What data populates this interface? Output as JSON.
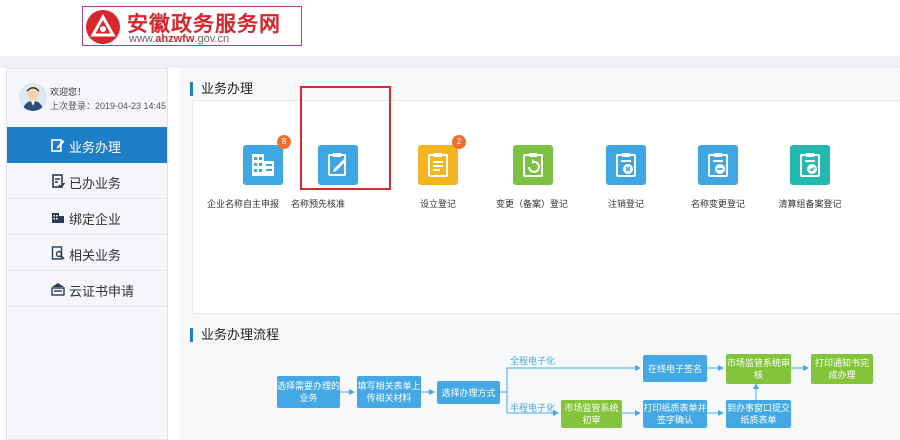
{
  "header": {
    "logo_title": "安徽政务服务网",
    "logo_url_prefix": "www.",
    "logo_url_bold": "ahzwfw",
    "logo_url_suffix": ".gov.cn"
  },
  "user": {
    "welcome": "欢迎您！",
    "last_login": "上次登录：2019-04-23 14:45"
  },
  "sidebar": {
    "items": [
      {
        "label": "业务办理",
        "icon": "edit-icon",
        "active": true
      },
      {
        "label": "已办业务",
        "icon": "document-check-icon",
        "active": false
      },
      {
        "label": "绑定企业",
        "icon": "building-icon",
        "active": false
      },
      {
        "label": "相关业务",
        "icon": "search-document-icon",
        "active": false
      },
      {
        "label": "云证书申请",
        "icon": "certificate-icon",
        "active": false
      }
    ]
  },
  "main": {
    "business_title": "业务办理",
    "flow_title": "业务办理流程",
    "tiles": [
      {
        "label": "企业名称自主申报",
        "color": "#3ea6e3",
        "badge": "8",
        "icon": "building-icon"
      },
      {
        "label": "名称预先核准",
        "color": "#3ea6e3",
        "badge": "",
        "icon": "clipboard-edit-icon"
      },
      {
        "label": "设立登记",
        "color": "#f5b421",
        "badge": "2",
        "icon": "clipboard-list-icon"
      },
      {
        "label": "变更（备案）登记",
        "color": "#7dc142",
        "badge": "",
        "icon": "clipboard-refresh-icon"
      },
      {
        "label": "注销登记",
        "color": "#3ea6e3",
        "badge": "",
        "icon": "clipboard-cancel-icon"
      },
      {
        "label": "名称变更登记",
        "color": "#3ea6e3",
        "badge": "",
        "icon": "clipboard-minus-icon"
      },
      {
        "label": "清算组备案登记",
        "color": "#25b7b2",
        "badge": "",
        "icon": "clipboard-stamp-icon"
      }
    ]
  },
  "flow": {
    "step1": "选择需要办理的业务",
    "step2": "填写相关表单上传相关材料",
    "step3": "选择办理方式",
    "full_label": "全程电子化",
    "half_label": "半程电子化",
    "online_sign": "在线电子签名",
    "market_review": "市场监管系统审核",
    "print_notice": "打印通知书完成办理",
    "market_initial": "市场监管系统初审",
    "print_form": "打印纸质表单并签字确认",
    "window_submit": "到办事窗口提交纸质表单"
  }
}
